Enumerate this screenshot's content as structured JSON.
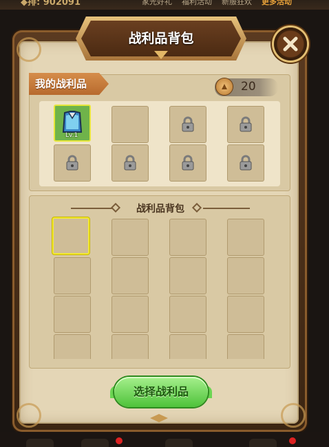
{
  "top_menu": {
    "left_text": "◆排: 902091",
    "items": [
      "家光好礼",
      "福利活动",
      "新服狂欢",
      "更多活动"
    ]
  },
  "dialog": {
    "title": "战利品背包",
    "close_label": "×"
  },
  "my_loot": {
    "tab_label": "我的战利品",
    "coin_count": "20",
    "slots": [
      {
        "state": "item",
        "level": "Lv.1"
      },
      {
        "state": "empty"
      },
      {
        "state": "locked"
      },
      {
        "state": "locked"
      },
      {
        "state": "locked"
      },
      {
        "state": "locked"
      },
      {
        "state": "locked"
      },
      {
        "state": "locked"
      }
    ]
  },
  "backpack": {
    "title": "战利品背包",
    "selected_slot": 0,
    "visible_rows": 4,
    "columns": 4
  },
  "actions": {
    "select_button": "选择战利品"
  },
  "colors": {
    "panel_bg": "#e4d6b6",
    "accent_orange": "#c97a3a",
    "button_green": "#4ec23a",
    "selected_yellow": "#f2e830"
  }
}
